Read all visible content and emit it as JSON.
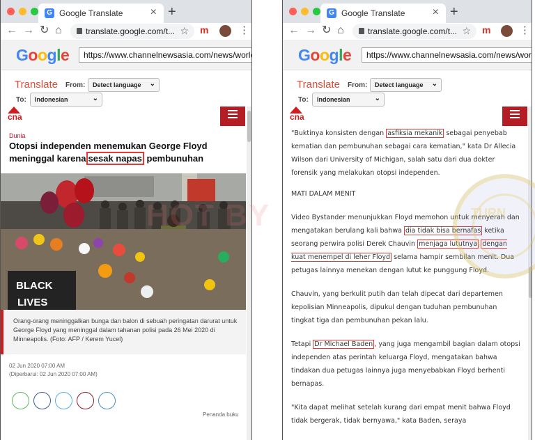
{
  "browser": {
    "tab_title": "Google Translate",
    "tab_close": "×",
    "new_tab": "+",
    "address": "translate.google.com/t..."
  },
  "gtranslate": {
    "logo_letters": [
      {
        "ch": "G",
        "color": "#4285f4"
      },
      {
        "ch": "o",
        "color": "#ea4335"
      },
      {
        "ch": "o",
        "color": "#fbbc05"
      },
      {
        "ch": "g",
        "color": "#4285f4"
      },
      {
        "ch": "l",
        "color": "#34a853"
      },
      {
        "ch": "e",
        "color": "#ea4335"
      }
    ],
    "url": "https://www.channelnewsasia.com/news/world/g",
    "title": "Translate",
    "from_label": "From:",
    "from_value": "Detect language",
    "to_label": "To:",
    "to_value": "Indonesian"
  },
  "left_page": {
    "category": "Dunia",
    "headline_before": "Otopsi independen menemukan George Floyd meninggal karena",
    "headline_highlight": "sesak napas",
    "headline_after": " pembunuhan",
    "photo_sign_1": "BLACK",
    "photo_sign_2": "LIVES",
    "caption": "Orang-orang meninggalkan bunga dan balon di sebuah peringatan darurat untuk George Floyd yang meninggal dalam tahanan polisi pada 26 Mei 2020 di Minneapolis. (Foto: AFP / Kerem Yucel)",
    "date": "02 Jun 2020 07:00 AM",
    "updated": "(Diperbarui: 02 Jun 2020 07:00 AM)",
    "share_colors": [
      "#5cb85c",
      "#3b5998",
      "#55acee",
      "#8b1a2b",
      "#4a90c2"
    ],
    "bookmark": "Penanda buku"
  },
  "right_page": {
    "p1_a": "\"Buktinya konsisten dengan ",
    "p1_h": "asfiksia mekanik",
    "p1_b": " sebagai penyebab kematian dan pembunuhan sebagai cara kematian,\" kata Dr Allecia Wilson dari University of Michigan, salah satu dari dua dokter forensik yang melakukan otopsi independen.",
    "subhead": "MATI DALAM MENIT",
    "p2_a": "Video Bystander menunjukkan Floyd memohon untuk menyerah dan mengatakan berulang kali bahwa ",
    "p2_h1": "dia tidak bisa bernafas",
    "p2_b": " ketika seorang perwira polisi Derek Chauvin ",
    "p2_h2": "menjaga lututnya",
    "p2_h3": "dengan kuat menempel di leher Floyd",
    "p2_c": " selama hampir sembilan menit. Dua petugas lainnya menekan dengan lutut ke punggung Floyd.",
    "p3": "Chauvin, yang berkulit putih dan telah dipecat dari departemen kepolisian Minneapolis, dipukul dengan tuduhan pembunuhan tingkat tiga dan pembunuhan pekan lalu.",
    "p4_a": "Tetapi ",
    "p4_h": "Dr Michael Baden",
    "p4_b": ", yang juga mengambil bagian dalam otopsi independen atas perintah keluarga Floyd, mengatakan bahwa tindakan dua petugas lainnya juga menyebabkan Floyd berhenti bernapas.",
    "p5": "\"Kita dapat melihat setelah kurang dari empat menit bahwa Floyd tidak bergerak, tidak bernyawa,\" kata Baden, seraya"
  },
  "colors": {
    "highlight": "#e53935",
    "cna_red": "#d01c1f",
    "menu_red": "#b41d23",
    "translate_red": "#dd4b39"
  }
}
